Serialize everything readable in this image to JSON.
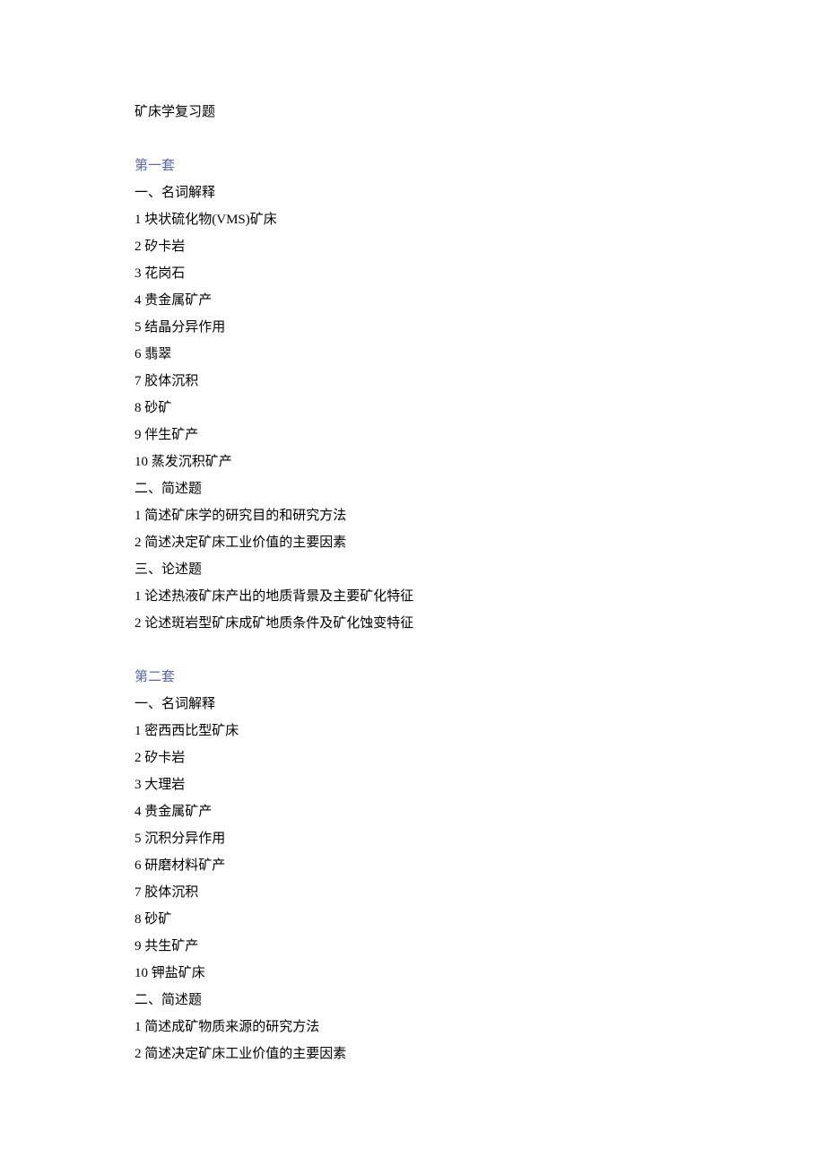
{
  "docTitle": "矿床学复习题",
  "sets": [
    {
      "header": "第一套",
      "parts": [
        {
          "heading": "一、名词解释",
          "items": [
            "1 块状硫化物(VMS)矿床",
            "2 矽卡岩",
            "3 花岗石",
            "4 贵金属矿产",
            "5 结晶分异作用",
            "6 翡翠",
            "7 胶体沉积",
            "8 砂矿",
            "9 伴生矿产",
            "10 蒸发沉积矿产"
          ]
        },
        {
          "heading": "二、简述题",
          "items": [
            "1 简述矿床学的研究目的和研究方法",
            "2 简述决定矿床工业价值的主要因素"
          ]
        },
        {
          "heading": "三、论述题",
          "items": [
            "1 论述热液矿床产出的地质背景及主要矿化特征",
            "2 论述斑岩型矿床成矿地质条件及矿化蚀变特征"
          ]
        }
      ]
    },
    {
      "header": "第二套",
      "parts": [
        {
          "heading": "一、名词解释",
          "items": [
            "1 密西西比型矿床",
            "2 矽卡岩",
            "3 大理岩",
            "4 贵金属矿产",
            "5 沉积分异作用",
            "6 研磨材料矿产",
            "7 胶体沉积",
            "8 砂矿",
            "9 共生矿产",
            "10 钾盐矿床"
          ]
        },
        {
          "heading": "二、简述题",
          "items": [
            "1 简述成矿物质来源的研究方法",
            "2 简述决定矿床工业价值的主要因素"
          ]
        }
      ]
    }
  ]
}
